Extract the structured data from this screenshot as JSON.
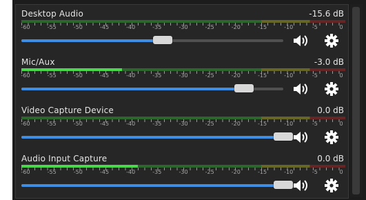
{
  "mixer": {
    "scale_labels": [
      "-60",
      "-55",
      "-50",
      "-45",
      "-40",
      "-35",
      "-30",
      "-25",
      "-20",
      "-15",
      "-10",
      "-5",
      "0"
    ],
    "channels": [
      {
        "name": "Desktop Audio",
        "db": "-15.6 dB",
        "volume": 0.54,
        "meter_level": 0.0,
        "mute_icon": "speaker-icon",
        "settings_icon": "gear-icon"
      },
      {
        "name": "Mic/Aux",
        "db": "-3.0 dB",
        "volume": 0.85,
        "meter_level": 0.31,
        "mute_icon": "speaker-icon",
        "settings_icon": "gear-icon"
      },
      {
        "name": "Video Capture Device",
        "db": "0.0 dB",
        "volume": 1.0,
        "meter_level": 0.0,
        "mute_icon": "speaker-icon",
        "settings_icon": "gear-icon"
      },
      {
        "name": "Audio Input Capture",
        "db": "0.0 dB",
        "volume": 1.0,
        "meter_level": 0.36,
        "mute_icon": "speaker-icon",
        "settings_icon": "gear-icon"
      }
    ]
  },
  "colors": {
    "meter_green": "#4cd84c",
    "slider_fill": "#3f8ee5",
    "panel_bg": "#262626"
  }
}
